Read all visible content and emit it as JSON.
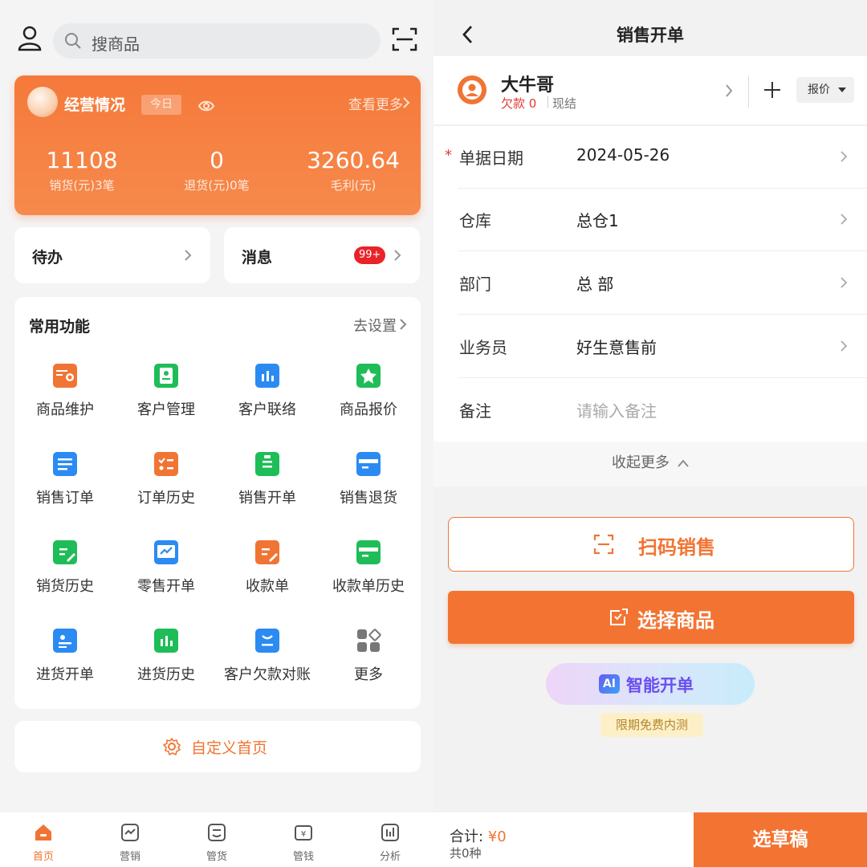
{
  "left": {
    "search": {
      "placeholder": "搜商品"
    },
    "summary": {
      "title": "经营情况",
      "period": "今日",
      "more": "查看更多",
      "stats": [
        {
          "value": "11108",
          "label": "销货(元)3笔"
        },
        {
          "value": "0",
          "label": "退货(元)0笔"
        },
        {
          "value": "3260.64",
          "label": "毛利(元)"
        }
      ]
    },
    "todo": {
      "label": "待办"
    },
    "messages": {
      "label": "消息",
      "badge": "99+"
    },
    "functions": {
      "title": "常用功能",
      "settings": "去设置",
      "items": [
        {
          "label": "商品维护",
          "icon": "product-maintain-icon",
          "color": "#f07534"
        },
        {
          "label": "客户管理",
          "icon": "customer-manage-icon",
          "color": "#1fbd58"
        },
        {
          "label": "客户联络",
          "icon": "customer-contact-icon",
          "color": "#2b8bf2"
        },
        {
          "label": "商品报价",
          "icon": "product-quote-icon",
          "color": "#1fbd58"
        },
        {
          "label": "销售订单",
          "icon": "sales-order-icon",
          "color": "#2b8bf2"
        },
        {
          "label": "订单历史",
          "icon": "order-history-icon",
          "color": "#f07534"
        },
        {
          "label": "销售开单",
          "icon": "sales-bill-icon",
          "color": "#1fbd58"
        },
        {
          "label": "销售退货",
          "icon": "sales-return-icon",
          "color": "#2b8bf2"
        },
        {
          "label": "销货历史",
          "icon": "sales-history-icon",
          "color": "#1fbd58"
        },
        {
          "label": "零售开单",
          "icon": "retail-bill-icon",
          "color": "#2b8bf2"
        },
        {
          "label": "收款单",
          "icon": "receipt-icon",
          "color": "#f07534"
        },
        {
          "label": "收款单历史",
          "icon": "receipt-history-icon",
          "color": "#1fbd58"
        },
        {
          "label": "进货开单",
          "icon": "purchase-bill-icon",
          "color": "#2b8bf2"
        },
        {
          "label": "进货历史",
          "icon": "purchase-history-icon",
          "color": "#1fbd58"
        },
        {
          "label": "客户欠款对账",
          "icon": "customer-debt-icon",
          "color": "#2b8bf2"
        },
        {
          "label": "更多",
          "icon": "more-grid-icon",
          "color": "#777777"
        }
      ]
    },
    "customize": "自定义首页",
    "tabs": [
      {
        "label": "首页",
        "icon": "home-icon"
      },
      {
        "label": "营销",
        "icon": "marketing-icon"
      },
      {
        "label": "管货",
        "icon": "goods-icon"
      },
      {
        "label": "管钱",
        "icon": "wallet-icon"
      },
      {
        "label": "分析",
        "icon": "analysis-icon"
      }
    ]
  },
  "right": {
    "title": "销售开单",
    "customer": {
      "name": "大牛哥",
      "debt": "欠款 0",
      "payment": "现结",
      "price_type": "报价"
    },
    "form": [
      {
        "key": "单据日期",
        "value": "2024-05-26",
        "required": true
      },
      {
        "key": "仓库",
        "value": "总仓1"
      },
      {
        "key": "部门",
        "value": "总 部"
      },
      {
        "key": "业务员",
        "value": "好生意售前"
      },
      {
        "key": "备注",
        "placeholder": "请输入备注"
      }
    ],
    "collapse": "收起更多",
    "scan_sale": "扫码销售",
    "select_goods": "选择商品",
    "ai_bill": "智能开单",
    "ai_badge": "AI",
    "trial": "限期免费内测",
    "total_label": "合计:",
    "total_value": "¥0",
    "count": "共0种",
    "draft": "选草稿"
  },
  "colors": {
    "accent": "#f37432",
    "danger": "#e53935",
    "ai": "#6a4ef0"
  }
}
